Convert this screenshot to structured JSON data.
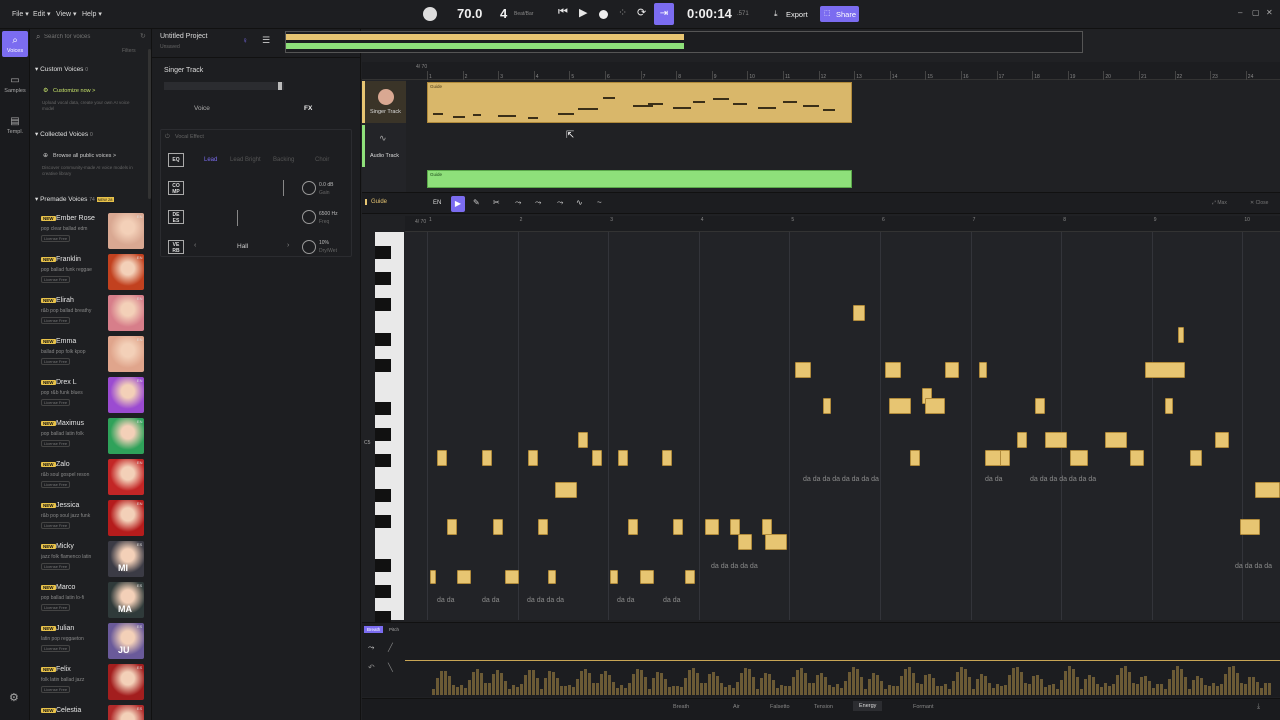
{
  "menu": {
    "file": "File ▾",
    "edit": "Edit ▾",
    "view": "View ▾",
    "help": "Help ▾"
  },
  "transport": {
    "tempo": "70.0",
    "beats": "4",
    "beats_unit": "Beat/Bar",
    "time": "0:00:14",
    "time_ms": ".571",
    "export": "Export",
    "share": "Share"
  },
  "nav": [
    {
      "label": "Voices",
      "icon": "voices-icon"
    },
    {
      "label": "Samples",
      "icon": "samples-icon"
    },
    {
      "label": "Templ.",
      "icon": "templates-icon"
    }
  ],
  "search": {
    "placeholder": "Search for voices",
    "filters": "Filters"
  },
  "sections": {
    "custom": "Custom Voices",
    "custom_count": "0",
    "customize": "Customize now >",
    "customize_desc": "Upload vocal data, create your own AI voice model",
    "collected": "Collected Voices",
    "collected_count": "0",
    "browse": "Browse all public voices >",
    "browse_desc": "Discover community-made AI voice models in creative library",
    "premade": "Premade Voices",
    "premade_count": "74",
    "premade_new": "NEW 28"
  },
  "voices": [
    {
      "name": "Ember Rose",
      "tags": "pop clear ballad edm",
      "color": "#d9a892",
      "lang": "EN"
    },
    {
      "name": "Franklin",
      "tags": "pop ballad funk reggae",
      "color": "#c2411f",
      "lang": "EN"
    },
    {
      "name": "Elirah",
      "tags": "r&b pop ballad breathy",
      "color": "#d77e8a",
      "lang": "EN"
    },
    {
      "name": "Emma",
      "tags": "ballad pop folk kpop",
      "color": "#e0a58c",
      "lang": "EN"
    },
    {
      "name": "Drex L",
      "tags": "pop r&b funk blues",
      "color": "#9b4bd1",
      "lang": "EN"
    },
    {
      "name": "Maximus",
      "tags": "pop ballad latin folk",
      "color": "#2fa25a",
      "lang": "EN"
    },
    {
      "name": "Zalo",
      "tags": "r&b soul gospel reson",
      "color": "#c32626",
      "lang": "EN"
    },
    {
      "name": "Jessica",
      "tags": "r&b pop soul jazz funk",
      "color": "#b51c1c",
      "lang": "EN"
    },
    {
      "name": "Micky",
      "tags": "jazz folk flamenco latin",
      "color": "#3b3b45",
      "lang": "ES",
      "mono": "MI"
    },
    {
      "name": "Marco",
      "tags": "pop ballad latin lo-fi",
      "color": "#2f3a3a",
      "lang": "ES",
      "mono": "MA"
    },
    {
      "name": "Julian",
      "tags": "latin pop reggaeton",
      "color": "#6a5a9a",
      "lang": "ES",
      "mono": "JU"
    },
    {
      "name": "Felix",
      "tags": "folk latin ballad jazz",
      "color": "#a31e1e",
      "lang": "ES"
    },
    {
      "name": "Celestia",
      "tags": "",
      "color": "#b12a2a",
      "lang": "ES"
    }
  ],
  "license": "License Free",
  "project": {
    "title": "Untitled Project",
    "sub": "Unsaved"
  },
  "fx": {
    "track": "Singer Track",
    "tab_voice": "Voice",
    "tab_fx": "FX",
    "vocal_effect": "Vocal Effect",
    "eq": "EQ",
    "eq_modes": [
      "Lead",
      "Lead Bright",
      "Backing",
      "Choir"
    ],
    "comp": "CO MP",
    "comp_val": "0.0 dB",
    "comp_sub": "Gain",
    "des": "DE ES",
    "des_val": "6500 Hz",
    "des_sub": "Freq",
    "verb": "VE RB",
    "verb_type": "Hall",
    "verb_val": "10%",
    "verb_sub": "Dry/Wet"
  },
  "tracks": [
    {
      "name": "Singer Track",
      "region": "Guide"
    },
    {
      "name": "Audio Track",
      "region": "Guide"
    }
  ],
  "ruler": [
    "1",
    "2",
    "3",
    "4",
    "5",
    "6",
    "7",
    "8",
    "9",
    "10",
    "11",
    "12",
    "13",
    "14",
    "15",
    "16",
    "17",
    "18",
    "19",
    "20",
    "21",
    "22",
    "23",
    "24"
  ],
  "time_sig": "4/ 70",
  "editor": {
    "track": "Guide",
    "lang": "EN",
    "max": "Max",
    "close": "Close",
    "c5": "C5",
    "lyric": "da"
  },
  "bottom_tabs": [
    "Breath",
    "Air",
    "Falsetto",
    "Tension",
    "Energy",
    "Formant"
  ],
  "bottom_small": [
    "Breath",
    "Pitch"
  ]
}
